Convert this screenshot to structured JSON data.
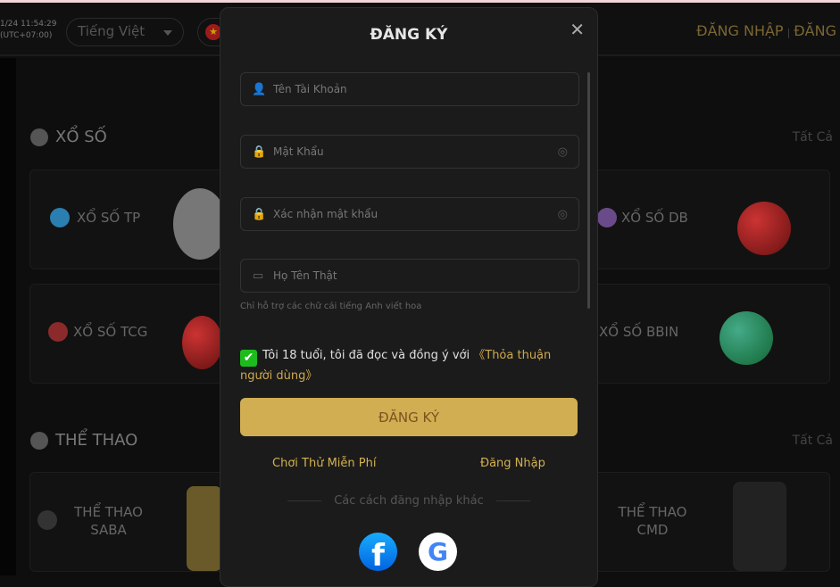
{
  "header": {
    "time": "1/24 11:54:29",
    "timezone": "(UTC+07:00)",
    "language": "Tiếng Việt",
    "login": "ĐĂNG NHẬP",
    "separator": "|",
    "register": "ĐĂNG"
  },
  "sections": [
    {
      "title": "XỔ SỐ",
      "all": "Tất Cả",
      "cards": [
        "XỔ SỐ TP",
        "XỔ SỐ DB",
        "XỔ SỐ TCG",
        "XỔ SỐ BBIN"
      ]
    },
    {
      "title": "THỂ THAO",
      "all": "Tất Cả",
      "cards": [
        "THỂ THAO SABA",
        "THỂ THAO CMD"
      ]
    }
  ],
  "modal": {
    "title": "ĐĂNG KÝ",
    "fields": {
      "username": "Tên Tài Khoản",
      "password": "Mật Khẩu",
      "confirm": "Xác nhận mật khẩu",
      "realname": "Họ Tên Thật"
    },
    "hint": "Chỉ hỗ trợ các chữ cái tiếng Anh viết hoa",
    "agree_text": "Tôi 18 tuổi, tôi đã đọc và đồng ý với ",
    "agree_link": "《Thỏa thuận người dùng》",
    "agree_checked": true,
    "submit": "ĐĂNG KÝ",
    "free_play": "Chơi Thử Miễn Phí",
    "login": "Đăng Nhập",
    "other_methods": "Các cách đăng nhập khác",
    "accent": "#d1ae52"
  }
}
